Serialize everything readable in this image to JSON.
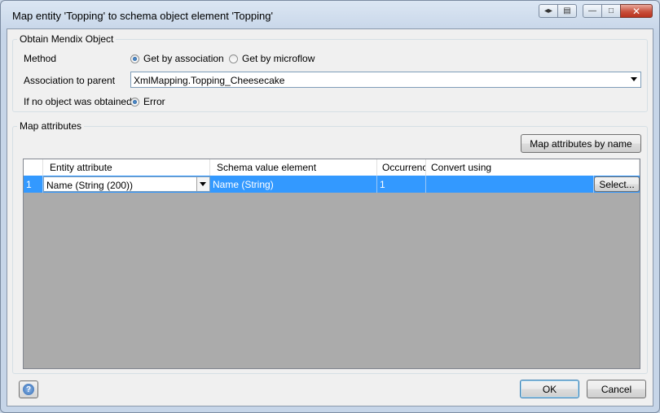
{
  "window": {
    "title": "Map entity 'Topping' to schema object element 'Topping'",
    "buttons": {
      "nav": "◂▸",
      "export": "▤",
      "minimize": "—",
      "maximize": "□",
      "close": "✕"
    }
  },
  "obtain": {
    "legend": "Obtain Mendix Object",
    "method_label": "Method",
    "method_options": [
      {
        "label": "Get by association",
        "selected": true
      },
      {
        "label": "Get by microflow",
        "selected": false
      }
    ],
    "association_label": "Association to parent",
    "association_value": "XmlMapping.Topping_Cheesecake",
    "no_object_label": "If no object was obtained",
    "no_object_option": {
      "label": "Error",
      "selected": true
    }
  },
  "attributes": {
    "legend": "Map attributes",
    "map_by_name_label": "Map attributes by name",
    "columns": [
      "",
      "Entity attribute",
      "Schema value element",
      "Occurrence",
      "Convert using"
    ],
    "rows": [
      {
        "index": "1",
        "entity_attribute": "Name (String (200))",
        "schema_value": "Name (String)",
        "occurrence": "1",
        "convert_using": "",
        "select_label": "Select..."
      }
    ]
  },
  "footer": {
    "help_icon": "?",
    "ok_label": "OK",
    "cancel_label": "Cancel"
  },
  "colors": {
    "selection": "#3399ff",
    "grid_background": "#ababab"
  }
}
